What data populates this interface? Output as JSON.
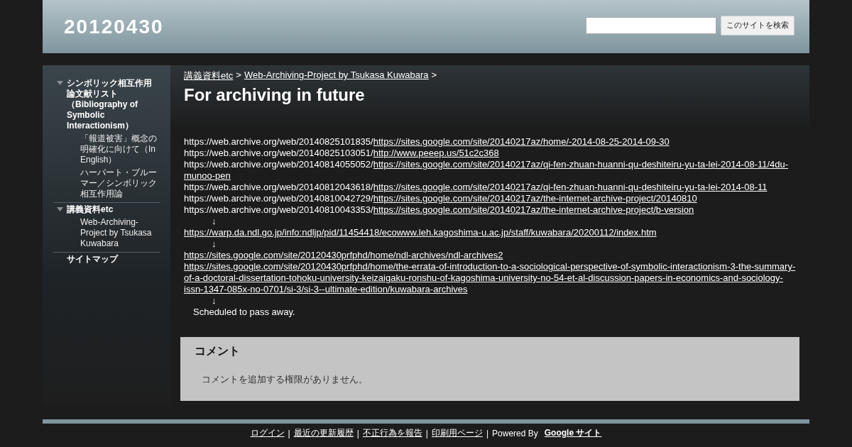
{
  "header": {
    "site_title": "20120430",
    "search": {
      "button": "このサイトを検索"
    }
  },
  "sidebar": {
    "items": [
      {
        "label": "シンボリック相互作用論文献リスト（Bibliography of Symbolic Interactionism）",
        "expanded": true,
        "children": [
          {
            "label": "「報道被害」概念の明確化に向けて（In English）"
          },
          {
            "label": "ハーバート・ブルーマー／シンボリック相互作用論"
          }
        ]
      },
      {
        "label": "講義資料etc",
        "expanded": true,
        "children": [
          {
            "label": "Web-Archiving-Project by Tsukasa Kuwabara"
          }
        ]
      },
      {
        "label": "サイトマップ"
      }
    ]
  },
  "breadcrumb": [
    {
      "label": "講義資料etc"
    },
    {
      "label": "Web-Archiving-Project by Tsukasa Kuwabara"
    }
  ],
  "breadcrumb_separator": ">",
  "page_title": "For archiving in future",
  "lines": [
    {
      "kind": "archive",
      "prefix": "https://web.archive.org/web/20140825101835/",
      "link": "https://sites.google.com/site/20140217az/home/-2014-08-25-2014-09-30"
    },
    {
      "kind": "archive",
      "prefix": "https://web.archive.org/web/20140825103051/",
      "link": "http://www.peeep.us/51c2c368"
    },
    {
      "kind": "archive",
      "prefix": "https://web.archive.org/web/20140814055052/",
      "link": "https://sites.google.com/site/20140217az/qi-fen-zhuan-huanni-qu-deshiteiru-yu-ta-lei-2014-08-11/4du-munoo-pen"
    },
    {
      "kind": "archive",
      "prefix": "https://web.archive.org/web/20140812043618/",
      "link": "https://sites.google.com/site/20140217az/qi-fen-zhuan-huanni-qu-deshiteiru-yu-ta-lei-2014-08-11"
    },
    {
      "kind": "archive",
      "prefix": "https://web.archive.org/web/20140810042729/",
      "link": "https://sites.google.com/site/20140217az/the-internet-archive-project/20140810"
    },
    {
      "kind": "archive",
      "prefix": "https://web.archive.org/web/20140810043353/",
      "link": "https://sites.google.com/site/20140217az/the-internet-archive-project/b-version"
    },
    {
      "kind": "arrow",
      "text": "↓"
    },
    {
      "kind": "link",
      "link": "https://warp.da.ndl.go.jp/info:ndljp/pid/11454418/ecowww.leh.kagoshima-u.ac.jp/staff/kuwabara/20200112/index.htm"
    },
    {
      "kind": "arrow",
      "text": "↓"
    },
    {
      "kind": "link",
      "link": "https://sites.google.com/site/20120430prfphd/home/ndl-archives/ndl-archives2"
    },
    {
      "kind": "link",
      "link": "https://sites.google.com/site/20120430prfphd/home/the-errata-of-introduction-to-a-sociological-perspective-of-symbolic-interactionism-3-the-summary-of-a-doctoral-dissertation-tohoku-university-keizaigaku-ronshu-of-kagoshima-university-no-54-et-al-discussion-papers-in-economics-and-sociology-issn-1347-085x-no-0701/si-3/si-3--ultimate-edition/kuwabara-archives"
    },
    {
      "kind": "arrow",
      "text": "↓"
    },
    {
      "kind": "text",
      "text": "Scheduled to pass away."
    }
  ],
  "comments": {
    "title": "コメント",
    "message": "コメントを追加する権限がありません。"
  },
  "footer": {
    "links": [
      {
        "label": "ログイン"
      },
      {
        "label": "最近の更新履歴"
      },
      {
        "label": "不正行為を報告"
      },
      {
        "label": "印刷用ページ"
      }
    ],
    "separator": "|",
    "powered_by": "Powered By",
    "brand": "Google サイト"
  }
}
